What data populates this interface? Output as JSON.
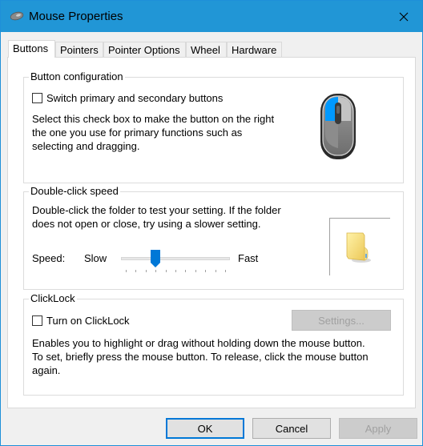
{
  "window": {
    "title": "Mouse Properties",
    "icon": "mouse-icon",
    "close_icon": "close-icon"
  },
  "tabs": [
    {
      "label": "Buttons",
      "active": true
    },
    {
      "label": "Pointers",
      "active": false
    },
    {
      "label": "Pointer Options",
      "active": false
    },
    {
      "label": "Wheel",
      "active": false
    },
    {
      "label": "Hardware",
      "active": false
    }
  ],
  "button_configuration": {
    "title": "Button configuration",
    "checkbox_label": "Switch primary and secondary buttons",
    "checked": false,
    "description_lines": [
      "Select this check box to make the button on the right",
      "the one you use for primary functions such as",
      "selecting and dragging."
    ],
    "image": "mouse-illustration-icon",
    "accent_color": "#0099ff"
  },
  "double_click_speed": {
    "title": "Double-click speed",
    "description_lines": [
      "Double-click the folder to test your setting. If the folder",
      "does not open or close, try using a slower setting."
    ],
    "speed_label": "Speed:",
    "slow_label": "Slow",
    "fast_label": "Fast",
    "slider": {
      "min": 0,
      "max": 10,
      "value": 3,
      "ticks": 11
    },
    "slider_color": "#0078d7",
    "test_folder_icon": "folder-icon"
  },
  "clicklock": {
    "title": "ClickLock",
    "checkbox_label": "Turn on ClickLock",
    "checked": false,
    "settings_button": "Settings...",
    "settings_enabled": false,
    "description_lines": [
      "Enables you to highlight or drag without holding down the mouse button.",
      "To set, briefly press the mouse button. To release, click the mouse button",
      "again."
    ]
  },
  "footer": {
    "ok": "OK",
    "cancel": "Cancel",
    "apply": "Apply",
    "apply_enabled": false
  },
  "colors": {
    "titlebar": "#2196d6",
    "accent": "#0078d7"
  }
}
